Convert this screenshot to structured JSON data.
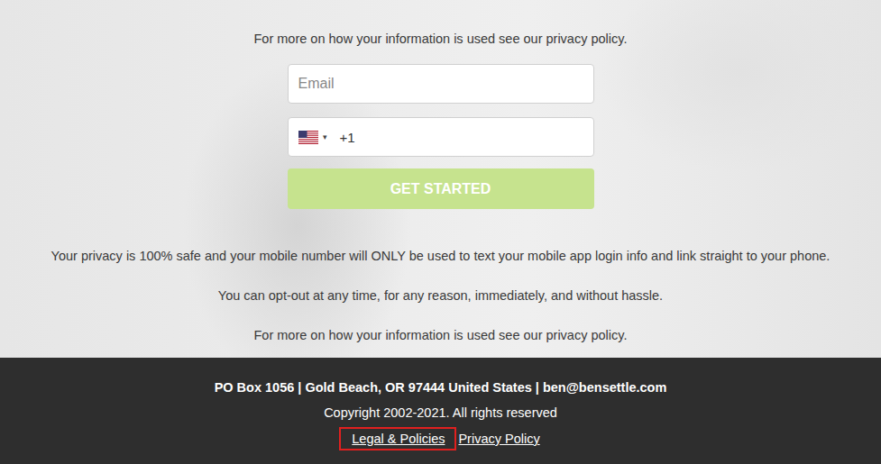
{
  "top_note": "For more on how your information is used see our privacy policy.",
  "form": {
    "email": {
      "placeholder": "Email"
    },
    "phone": {
      "dropdown_arrow": "▾",
      "dial_code": "+1"
    },
    "submit": {
      "label": "GET STARTED",
      "disabled": true
    }
  },
  "notes": [
    "Your privacy is 100% safe and your mobile number will ONLY be used to text your mobile app login info and link straight to your phone.",
    "You can opt-out at any time, for any reason, immediately, and without hassle.",
    "For more on how your information is used see our privacy policy."
  ],
  "footer": {
    "address": "PO Box 1056 | Gold Beach, OR 97444 United States | ben@bensettle.com",
    "copyright": "Copyright 2002-2021. All rights reserved",
    "links": [
      {
        "label": "Legal & Policies",
        "highlighted": true
      },
      {
        "label": "Privacy Policy",
        "highlighted": false
      }
    ]
  }
}
